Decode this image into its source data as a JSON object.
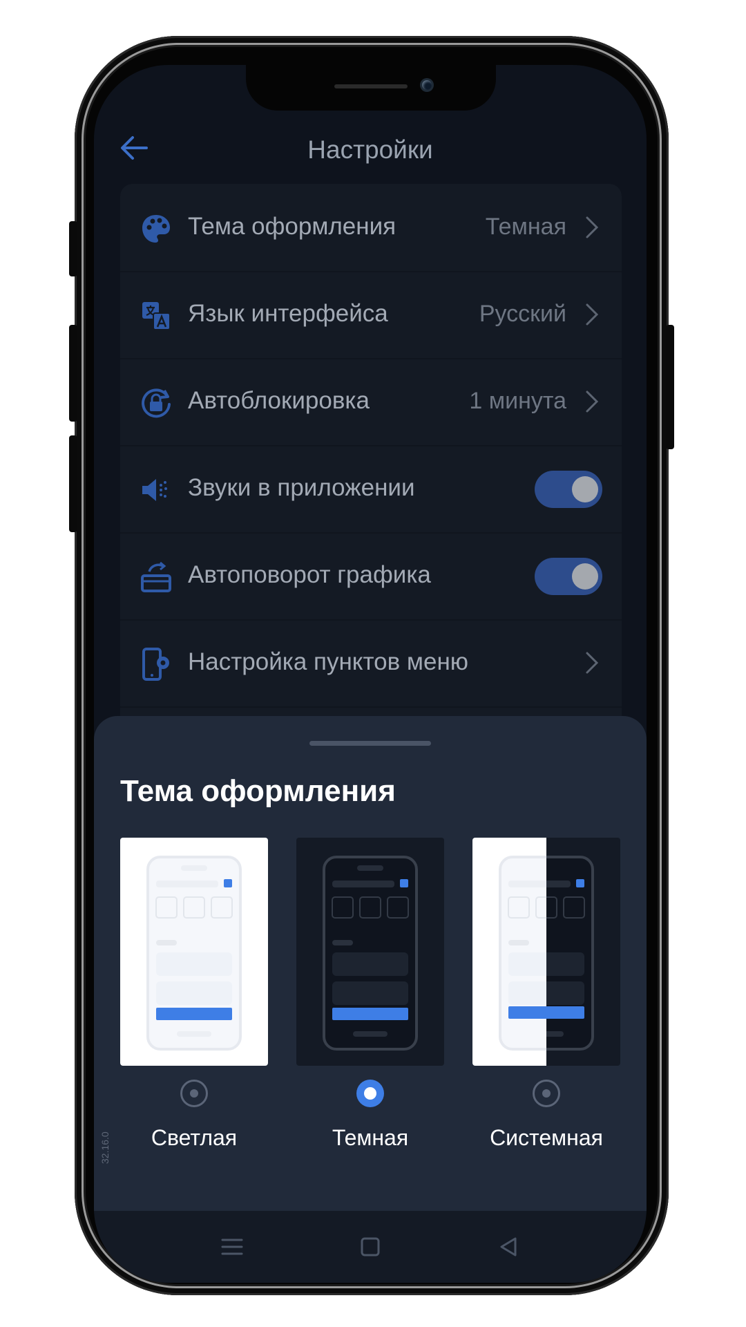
{
  "header": {
    "title": "Настройки",
    "back_icon": "arrow-left-icon"
  },
  "settings": [
    {
      "label": "Тема оформления",
      "value": "Темная",
      "icon": "palette-icon",
      "control": "chevron"
    },
    {
      "label": "Язык интерфейса",
      "value": "Русский",
      "icon": "translate-icon",
      "control": "chevron"
    },
    {
      "label": "Автоблокировка",
      "value": "1 минута",
      "icon": "auto-lock-icon",
      "control": "chevron"
    },
    {
      "label": "Звуки в приложении",
      "icon": "speaker-icon",
      "control": "toggle",
      "toggle_on": true
    },
    {
      "label": "Автоповорот графика",
      "icon": "rotate-screen-icon",
      "control": "toggle",
      "toggle_on": true
    },
    {
      "label": "Настройка пунктов меню",
      "icon": "phone-settings-icon",
      "control": "chevron"
    }
  ],
  "sheet": {
    "title": "Тема оформления",
    "options": [
      {
        "label": "Светлая",
        "selected": false
      },
      {
        "label": "Темная",
        "selected": true
      },
      {
        "label": "Системная",
        "selected": false
      }
    ]
  },
  "version": "32.16.0",
  "colors": {
    "accent": "#3e7ee6",
    "screen_bg": "#0e131d",
    "card_bg": "#141a24",
    "sheet_bg": "#212a3a",
    "toggle_on": "#2d4c8c"
  },
  "navbar": {
    "icons": [
      "menu-icon",
      "home-square-icon",
      "back-triangle-icon"
    ]
  }
}
